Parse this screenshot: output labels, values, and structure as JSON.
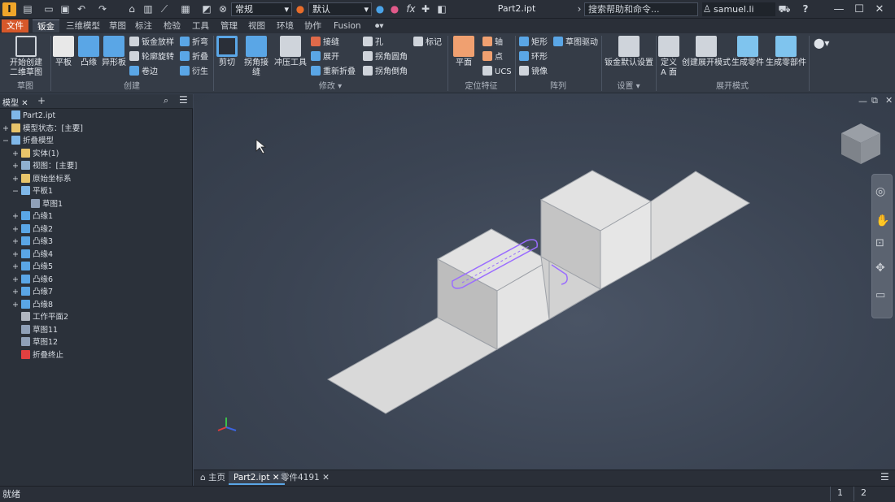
{
  "titlebar": {
    "app_logo": "I",
    "style_value": "常规",
    "appearance_value": "默认",
    "fx": "fx",
    "doc_title": "Part2.ipt",
    "search_placeholder": "搜索帮助和命令...",
    "user": "samuel.li",
    "help": "?"
  },
  "tabs": [
    "文件",
    "钣金",
    "三维模型",
    "草图",
    "标注",
    "检验",
    "工具",
    "管理",
    "视图",
    "环境",
    "协作",
    "Fusion"
  ],
  "ribbon": {
    "sketch": {
      "label": "草图",
      "start_sketch": "开始创建\n二维草图"
    },
    "create": {
      "label": "创建",
      "face": "平板",
      "flange": "凸缘",
      "contour_flange": "异形板",
      "lofted_flange": "钣金放样",
      "contour_roll": "轮廓旋转",
      "hem": "卷边",
      "fold": "折弯",
      "fold2": "折叠",
      "derive": "衍生"
    },
    "modify": {
      "label": "修改",
      "cut": "剪切",
      "corner_seam": "拐角接缝",
      "punch": "冲压工具",
      "rip": "接缝",
      "unfold": "展开",
      "refold": "重新折叠",
      "hole": "孔",
      "corner_round": "拐角圆角",
      "corner_chamfer": "拐角倒角",
      "mark": "标记"
    },
    "work": {
      "label": "定位特征",
      "plane": "平面",
      "axis": "轴",
      "point": "点",
      "ucs": "UCS"
    },
    "pattern": {
      "label": "阵列",
      "rect": "矩形",
      "circ": "环形",
      "mirror": "镜像",
      "sketch_driven": "草图驱动"
    },
    "setup": {
      "label": "设置",
      "defaults": "钣金默认设置"
    },
    "flat": {
      "label": "展开模式",
      "define_a": "定义\nA 面",
      "create_flat": "创建展开模式",
      "gen_part": "生成零件",
      "gen_parts": "生成零部件"
    }
  },
  "browser": {
    "tab": "模型",
    "nodes": [
      {
        "label": "Part2.ipt",
        "indent": 0,
        "pm": "",
        "color": "#7fb7e8"
      },
      {
        "label": "模型状态：[主要]",
        "indent": 0,
        "pm": "+",
        "color": "#e8c46a"
      },
      {
        "label": "折叠模型",
        "indent": 0,
        "pm": "−",
        "color": "#7fb7e8"
      },
      {
        "label": "实体(1)",
        "indent": 1,
        "pm": "+",
        "color": "#e8c46a"
      },
      {
        "label": "视图：[主要]",
        "indent": 1,
        "pm": "+",
        "color": "#8fb0d0"
      },
      {
        "label": "原始坐标系",
        "indent": 1,
        "pm": "+",
        "color": "#e8c46a"
      },
      {
        "label": "平板1",
        "indent": 1,
        "pm": "−",
        "color": "#7fb7e8"
      },
      {
        "label": "草图1",
        "indent": 2,
        "pm": "",
        "color": "#8fa0b8"
      },
      {
        "label": "凸缘1",
        "indent": 1,
        "pm": "+",
        "color": "#5aa6e6"
      },
      {
        "label": "凸缘2",
        "indent": 1,
        "pm": "+",
        "color": "#5aa6e6"
      },
      {
        "label": "凸缘3",
        "indent": 1,
        "pm": "+",
        "color": "#5aa6e6"
      },
      {
        "label": "凸缘4",
        "indent": 1,
        "pm": "+",
        "color": "#5aa6e6"
      },
      {
        "label": "凸缘5",
        "indent": 1,
        "pm": "+",
        "color": "#5aa6e6"
      },
      {
        "label": "凸缘6",
        "indent": 1,
        "pm": "+",
        "color": "#5aa6e6"
      },
      {
        "label": "凸缘7",
        "indent": 1,
        "pm": "+",
        "color": "#5aa6e6"
      },
      {
        "label": "凸缘8",
        "indent": 1,
        "pm": "+",
        "color": "#5aa6e6"
      },
      {
        "label": "工作平面2",
        "indent": 1,
        "pm": "",
        "color": "#b0b6c0"
      },
      {
        "label": "草图11",
        "indent": 1,
        "pm": "",
        "color": "#8fa0b8"
      },
      {
        "label": "草图12",
        "indent": 1,
        "pm": "",
        "color": "#8fa0b8"
      },
      {
        "label": "折叠终止",
        "indent": 1,
        "pm": "",
        "color": "#e04040"
      }
    ]
  },
  "doctabs": {
    "home": "主页",
    "tab1": "Part2.ipt",
    "tab2": "零件4191"
  },
  "status": {
    "text": "就绪",
    "num1": "1",
    "num2": "2"
  },
  "colors": {
    "accent_file": "#d6582a",
    "model_face": "#d8d8d8",
    "sketch_profile": "#9a6cff"
  }
}
